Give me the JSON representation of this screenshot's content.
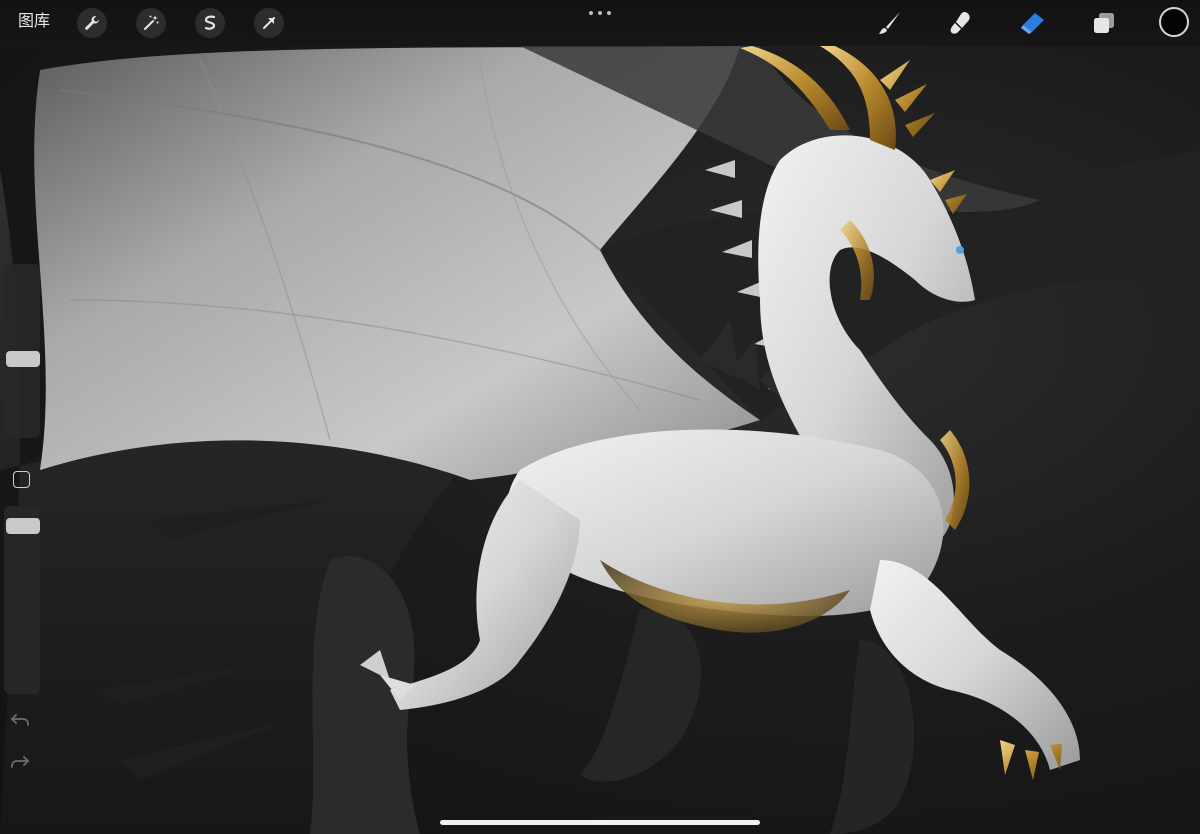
{
  "toolbar": {
    "gallery_label": "图库",
    "left_tools": [
      "wrench-icon",
      "magic-wand-icon",
      "selection-icon",
      "transform-arrow-icon"
    ],
    "right_tools": [
      "brush-icon",
      "smudge-icon",
      "eraser-icon",
      "layers-icon"
    ],
    "active_tool": "eraser-icon",
    "active_color": "#2a7de1",
    "current_color": "#050505"
  },
  "sidebar": {
    "size_slider_level": 0.45,
    "opacity_slider_level": 0.94
  },
  "canvas": {
    "subject": "white-dragon-artwork"
  }
}
